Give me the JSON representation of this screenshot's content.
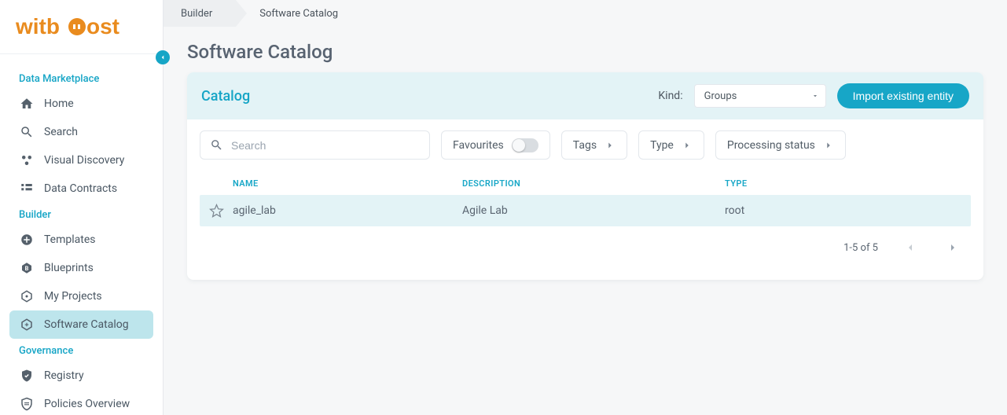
{
  "brand": "witboost",
  "breadcrumb": {
    "first": "Builder",
    "last": "Software Catalog"
  },
  "page_title": "Software Catalog",
  "sidebar": {
    "sections": [
      {
        "title": "Data Marketplace",
        "items": [
          {
            "label": "Home",
            "icon": "home-icon"
          },
          {
            "label": "Search",
            "icon": "search-icon"
          },
          {
            "label": "Visual Discovery",
            "icon": "visual-discovery-icon"
          },
          {
            "label": "Data Contracts",
            "icon": "data-contracts-icon"
          }
        ]
      },
      {
        "title": "Builder",
        "items": [
          {
            "label": "Templates",
            "icon": "templates-icon"
          },
          {
            "label": "Blueprints",
            "icon": "blueprints-icon"
          },
          {
            "label": "My Projects",
            "icon": "projects-icon"
          },
          {
            "label": "Software Catalog",
            "icon": "catalog-icon",
            "active": true
          }
        ]
      },
      {
        "title": "Governance",
        "items": [
          {
            "label": "Registry",
            "icon": "registry-icon"
          },
          {
            "label": "Policies Overview",
            "icon": "policies-icon"
          }
        ]
      }
    ]
  },
  "catalog": {
    "header_title": "Catalog",
    "kind_label": "Kind:",
    "kind_value": "Groups",
    "import_label": "Import existing entity",
    "search_placeholder": "Search",
    "filters": {
      "favourites": "Favourites",
      "tags": "Tags",
      "type": "Type",
      "processing_status": "Processing status"
    },
    "columns": {
      "name": "NAME",
      "description": "DESCRIPTION",
      "type": "TYPE"
    },
    "rows": [
      {
        "name": "agile_lab",
        "description": "Agile Lab",
        "type": "root"
      }
    ],
    "pager_text": "1-5 of 5"
  }
}
